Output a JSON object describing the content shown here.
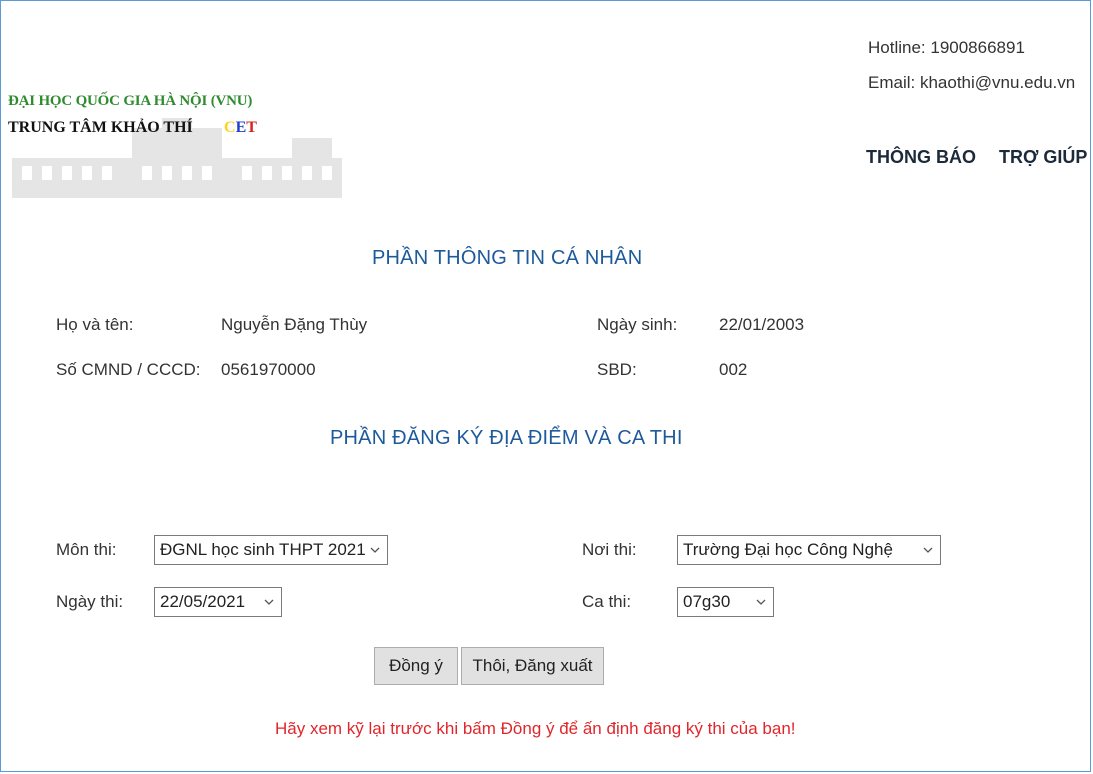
{
  "header": {
    "university_name": "ĐẠI HỌC QUỐC GIA HÀ NỘI (VNU)",
    "center_name": "TRUNG TÂM KHẢO THÍ",
    "cet_letters": [
      "C",
      "E",
      "T"
    ],
    "hotline": "Hotline: 1900866891",
    "email": "Email: khaothi@vnu.edu.vn",
    "nav": [
      "THÔNG BÁO",
      "TRỢ GIÚP"
    ]
  },
  "personal": {
    "title": "PHẦN THÔNG TIN CÁ NHÂN",
    "name_label": "Họ và tên:",
    "name_value": "Nguyễn Đặng Thùy",
    "dob_label": "Ngày sinh:",
    "dob_value": "22/01/2003",
    "id_label": "Số CMND / CCCD:",
    "id_value": "0561970000",
    "sbd_label": "SBD:",
    "sbd_value": "002"
  },
  "registration": {
    "title": "PHẦN ĐĂNG KÝ ĐỊA ĐIỂM VÀ CA THI",
    "subject_label": "Môn thi:",
    "subject_value": "ĐGNL học sinh THPT 2021",
    "location_label": "Nơi thi:",
    "location_value": "Trường Đại học Công Nghệ",
    "date_label": "Ngày thi:",
    "date_value": "22/05/2021",
    "session_label": "Ca thi:",
    "session_value": "07g30"
  },
  "actions": {
    "agree_label": "Đồng ý",
    "logout_label": "Thôi, Đăng xuất",
    "warning": "Hãy xem kỹ lại trước khi bấm Đồng ý để ấn định đăng ký thi của bạn!"
  },
  "colors": {
    "university_green": "#2e8b2e",
    "cet_c": "#ffd21f",
    "cet_e": "#1e3fcf",
    "cet_t": "#d82020",
    "section_blue": "#1e5a9a",
    "warning_red": "#e0262b",
    "frame_border": "#5b9bd5"
  }
}
